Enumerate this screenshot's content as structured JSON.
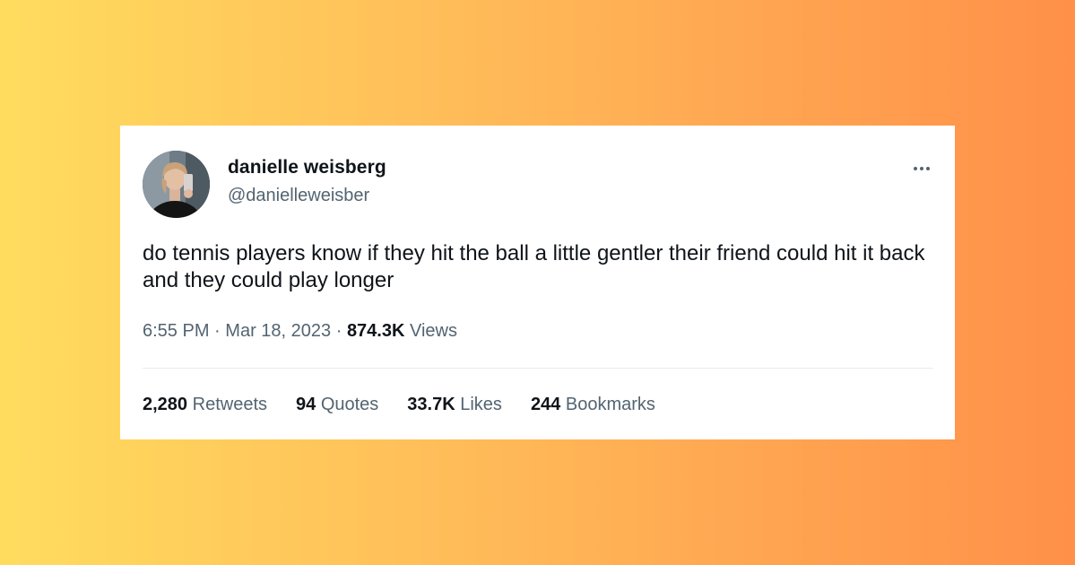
{
  "tweet": {
    "author": {
      "display_name": "danielle weisberg",
      "handle": "@danielleweisber",
      "avatar_icon": "avatar-photo"
    },
    "more_icon": "more-horizontal-icon",
    "text": "do tennis players know if they hit the ball a little gentler their friend could hit it back and they could play longer",
    "meta": {
      "time": "6:55 PM",
      "separator": "·",
      "date": "Mar 18, 2023",
      "views_count": "874.3K",
      "views_label": "Views"
    },
    "stats": [
      {
        "count": "2,280",
        "label": "Retweets"
      },
      {
        "count": "94",
        "label": "Quotes"
      },
      {
        "count": "33.7K",
        "label": "Likes"
      },
      {
        "count": "244",
        "label": "Bookmarks"
      }
    ]
  },
  "colors": {
    "background_gradient_start": "#ffdc5e",
    "background_gradient_end": "#ff9048",
    "card": "#ffffff",
    "primary_text": "#0f1419",
    "secondary_text": "#536471"
  }
}
